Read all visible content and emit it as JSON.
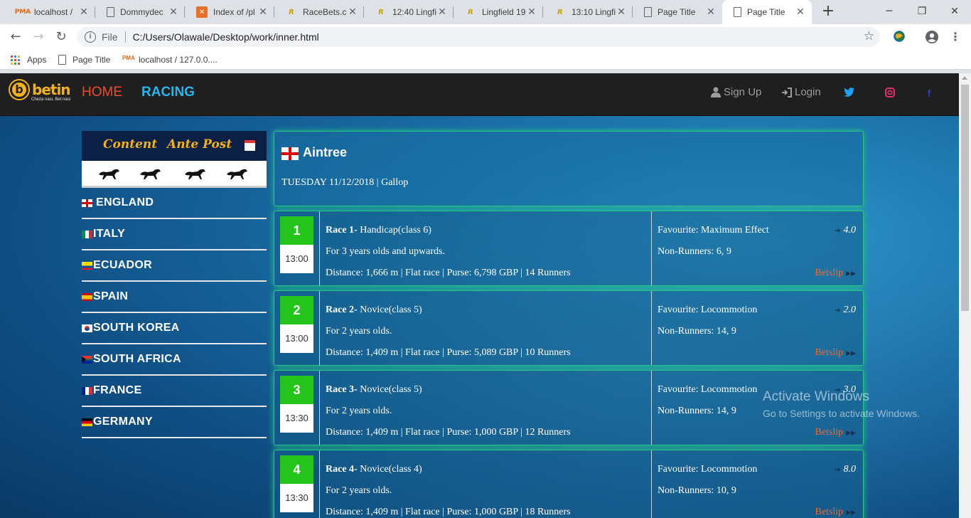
{
  "browser": {
    "tabs": [
      {
        "title": "localhost /",
        "favicon": "pma"
      },
      {
        "title": "Dommydec",
        "favicon": "doc"
      },
      {
        "title": "Index of /pl",
        "favicon": "idx"
      },
      {
        "title": "RaceBets.co",
        "favicon": "rb"
      },
      {
        "title": "12:40 Lingfi",
        "favicon": "rb"
      },
      {
        "title": "Lingfield 19",
        "favicon": "rb"
      },
      {
        "title": "13:10 Lingfi",
        "favicon": "rb"
      },
      {
        "title": "Page Title",
        "favicon": "doc"
      },
      {
        "title": "Page Title",
        "favicon": "doc",
        "active": true
      }
    ],
    "omnibox": {
      "scheme_label": "File",
      "url": "C:/Users/Olawale/Desktop/work/inner.html"
    },
    "bookmarks": [
      {
        "label": "Apps",
        "icon": "apps-grid-icon"
      },
      {
        "label": "Page Title",
        "icon": "doc-icon"
      },
      {
        "label": "localhost / 127.0.0....",
        "icon": "pma-icon"
      }
    ]
  },
  "site": {
    "logo_text": "betin",
    "logo_letter": "b",
    "logo_tagline": "Cheza nasi, Bet nasi",
    "nav": {
      "home": "HOME",
      "racing": "RACING",
      "signup": "Sign Up",
      "login": "Login"
    },
    "social_icons": [
      "twitter-icon",
      "instagram-icon",
      "facebook-icon"
    ],
    "colors": {
      "home": "#ee4b2b",
      "racing": "#2ab4e8",
      "accent": "#f4b11c",
      "race_number": "#24c41d",
      "betslip": "#f2692b",
      "glow": "#20c080"
    }
  },
  "sidebar": {
    "tabs": {
      "content": "Content",
      "ante_post": "Ante Post"
    },
    "countries": [
      {
        "name": "ENGLAND",
        "flag": "england"
      },
      {
        "name": "ITALY",
        "flag": "italy"
      },
      {
        "name": "ECUADOR",
        "flag": "ecuador"
      },
      {
        "name": "SPAIN",
        "flag": "spain"
      },
      {
        "name": "SOUTH KOREA",
        "flag": "korea"
      },
      {
        "name": "SOUTH AFRICA",
        "flag": "south-africa"
      },
      {
        "name": "FRANCE",
        "flag": "france"
      },
      {
        "name": "GERMANY",
        "flag": "germany"
      }
    ]
  },
  "venue": {
    "name": "Aintree",
    "meta": "TUESDAY 11/12/2018 | Gallop"
  },
  "races": [
    {
      "number": "1",
      "time": "13:00",
      "title": "Race 1-",
      "type": "Handicap(class 6)",
      "eligibility": "For 3 years olds and upwards.",
      "details": "Distance: 1,666 m | Flat race | Purse: 6,798 GBP | 14 Runners",
      "favourite": "Favourite: Maximum Effect",
      "odds": "4.0",
      "non_runners": "Non-Runners: 6, 9",
      "betslip": "Betslip"
    },
    {
      "number": "2",
      "time": "13:00",
      "title": "Race 2-",
      "type": "Novice(class 5)",
      "eligibility": "For 2 years olds.",
      "details": "Distance: 1,409 m | Flat race | Purse: 5,089 GBP | 10 Runners",
      "favourite": "Favourite: Locommotion",
      "odds": "2.0",
      "non_runners": "Non-Runners: 14, 9",
      "betslip": "Betslip"
    },
    {
      "number": "3",
      "time": "13:30",
      "title": "Race 3-",
      "type": "Novice(class 5)",
      "eligibility": "For 2 years olds.",
      "details": "Distance: 1,409 m | Flat race | Purse: 1,000 GBP | 12 Runners",
      "favourite": "Favourite: Locommotion",
      "odds": "3.0",
      "non_runners": "Non-Runners: 14, 9",
      "betslip": "Betslip"
    },
    {
      "number": "4",
      "time": "13:30",
      "title": "Race 4-",
      "type": "Novice(class 4)",
      "eligibility": "For 2 years olds.",
      "details": "Distance: 1,409 m | Flat race | Purse: 1,000 GBP | 18 Runners",
      "favourite": "Favourite: Locommotion",
      "odds": "8.0",
      "non_runners": "Non-Runners: 10, 9",
      "betslip": "Betslip"
    }
  ],
  "os_watermark": {
    "line1": "Activate Windows",
    "line2": "Go to Settings to activate Windows."
  }
}
